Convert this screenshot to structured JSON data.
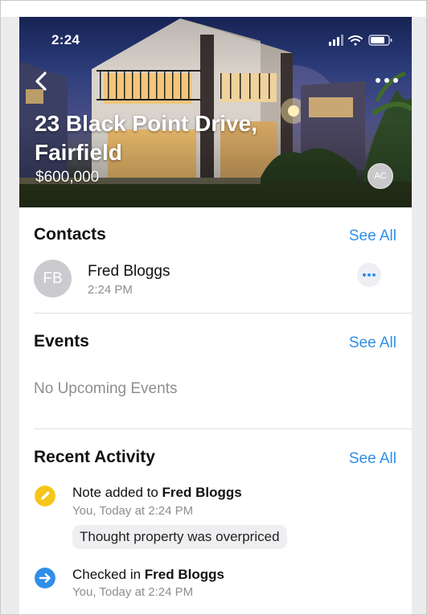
{
  "status_bar": {
    "time": "2:24"
  },
  "property": {
    "address": "23 Black Point Drive, Fairfield",
    "price": "$600,000",
    "agent_initials": "AC"
  },
  "contacts": {
    "title": "Contacts",
    "see_all": "See All",
    "items": [
      {
        "initials": "FB",
        "name": "Fred Bloggs",
        "time": "2:24 PM"
      }
    ]
  },
  "events": {
    "title": "Events",
    "see_all": "See All",
    "empty": "No Upcoming Events"
  },
  "recent_activity": {
    "title": "Recent Activity",
    "see_all": "See All",
    "items": [
      {
        "icon": "pencil-icon",
        "icon_color": "#f5c518",
        "prefix": "Note added to ",
        "contact": "Fred Bloggs",
        "meta": "You, Today at 2:24 PM",
        "note": "Thought property was overpriced"
      },
      {
        "icon": "arrow-right-icon",
        "icon_color": "#2f8ee8",
        "prefix": "Checked in ",
        "contact": "Fred Bloggs",
        "meta": "You, Today at 2:24 PM"
      }
    ]
  },
  "colors": {
    "accent": "#2f8ee8",
    "note_icon": "#f5c518",
    "checkin_icon": "#2f8ee8"
  }
}
